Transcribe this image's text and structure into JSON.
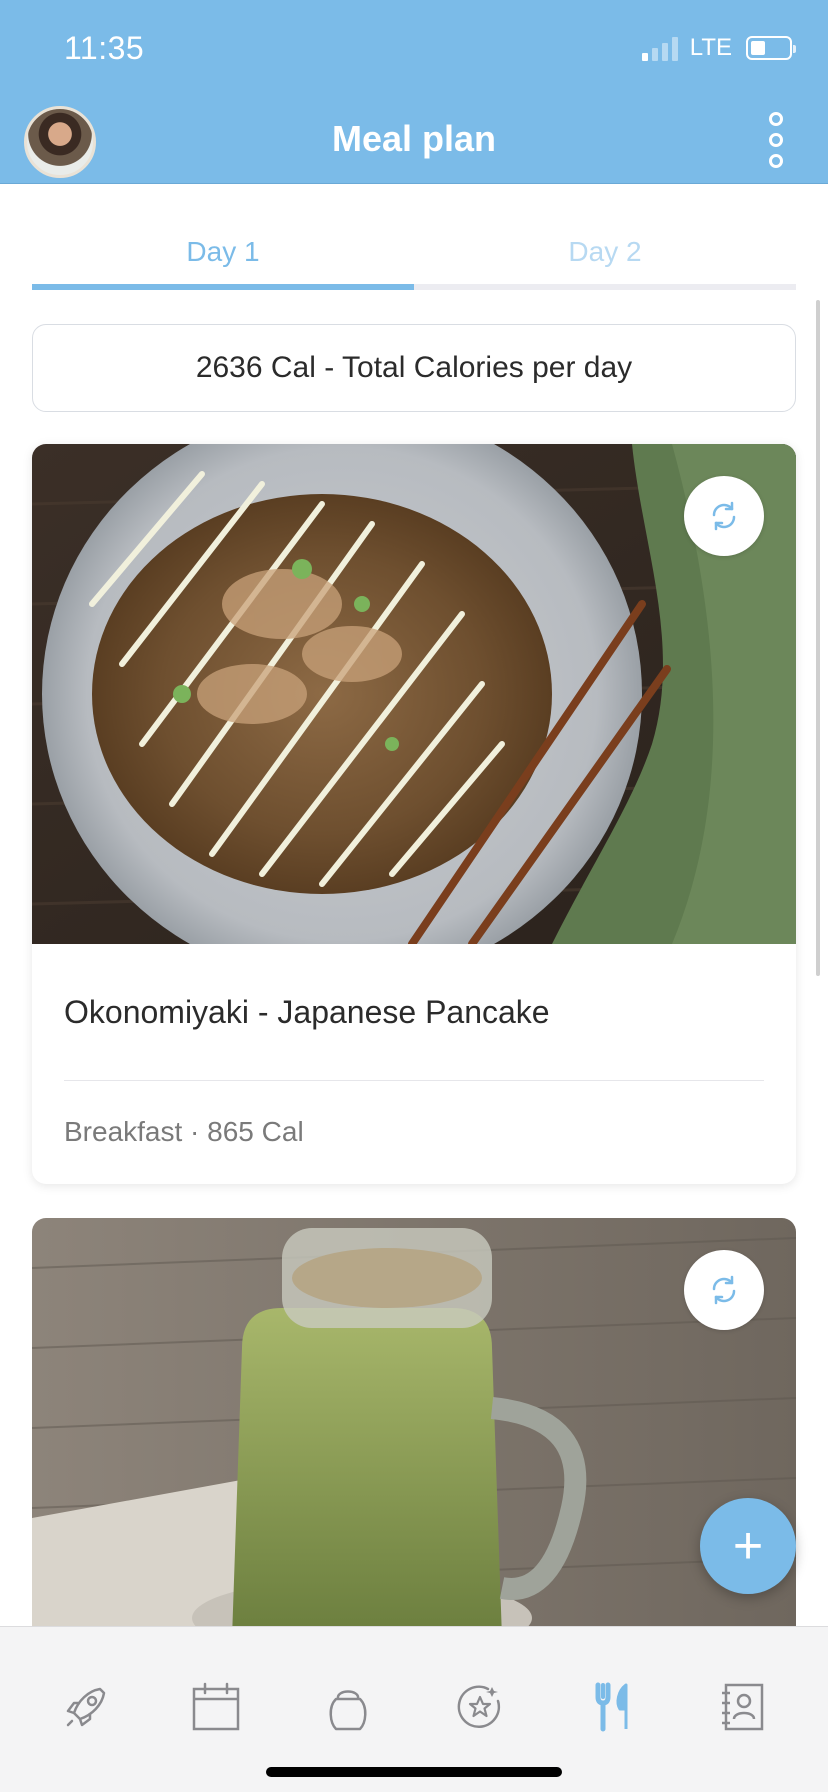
{
  "status_bar": {
    "time": "11:35",
    "network": "LTE"
  },
  "header": {
    "title": "Meal plan"
  },
  "tabs": [
    {
      "label": "Day 1",
      "active": true
    },
    {
      "label": "Day 2",
      "active": false
    }
  ],
  "summary": {
    "total_calories_text": "2636 Cal - Total Calories per day"
  },
  "meals": [
    {
      "name": "Okonomiyaki - Japanese Pancake",
      "meta": "Breakfast · 865 Cal"
    }
  ],
  "bottom_nav": [
    {
      "icon": "rocket-icon",
      "active": false
    },
    {
      "icon": "calendar-icon",
      "active": false
    },
    {
      "icon": "kettlebell-icon",
      "active": false
    },
    {
      "icon": "star-badge-icon",
      "active": false
    },
    {
      "icon": "fork-knife-icon",
      "active": true
    },
    {
      "icon": "contacts-book-icon",
      "active": false
    }
  ],
  "fab": {
    "symbol": "+"
  },
  "colors": {
    "accent": "#7bbbe8",
    "text": "#2b2b2b",
    "muted": "#7a7a7a"
  }
}
